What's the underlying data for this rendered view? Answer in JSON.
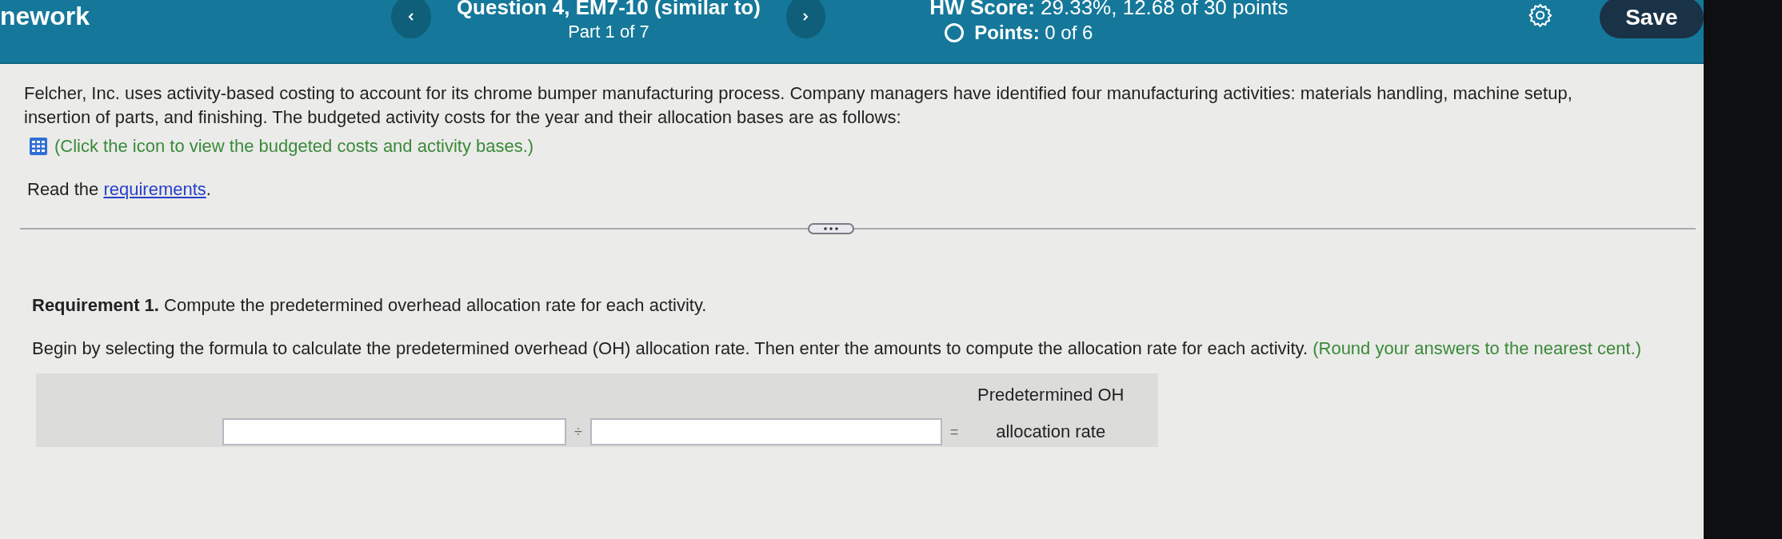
{
  "header": {
    "app_title": "nework",
    "question_title": "Question 4, EM7-10 (similar to)",
    "part": "Part 1 of 7",
    "hw_score": "**HW Score:** 29.33%, 12.68 of 30 points",
    "points": "**Points:** 0 of 6",
    "save_label": "Save"
  },
  "intro": {
    "text": "Felcher, Inc. uses activity-based costing to account for its chrome bumper manufacturing process. Company managers have identified four manufacturing activities: materials handling, machine setup, insertion of parts, and finishing. The budgeted activity costs for the year and their allocation bases are as follows:",
    "data_link": "(Click the icon to view the budgeted costs and activity bases.)",
    "read_prefix": "Read the",
    "read_link": "requirements",
    "read_suffix": "."
  },
  "requirement": {
    "title": "**Requirement 1.** Compute the predetermined overhead allocation rate for each activity.",
    "instruction": "Begin by selecting the formula to calculate the predetermined overhead (OH) allocation rate. Then enter the amounts to compute the allocation rate for each activity.",
    "hint": "(Round your answers to the nearest cent.)"
  },
  "formula": {
    "operator": "÷",
    "equals": "=",
    "result_lines": [
      "Predetermined OH",
      "allocation rate"
    ]
  }
}
